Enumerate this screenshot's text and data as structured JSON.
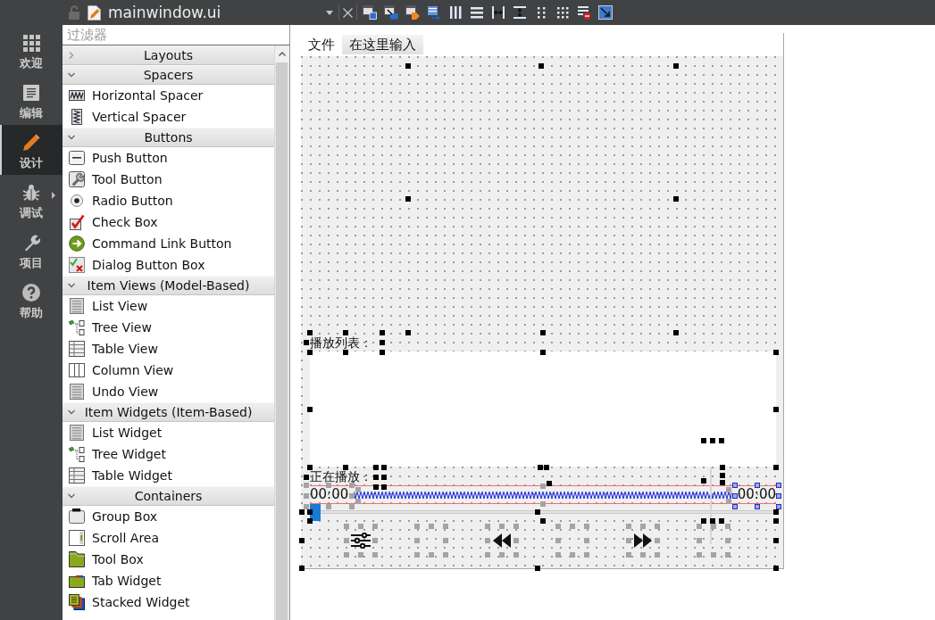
{
  "top_bar": {
    "file_name": "mainwindow.ui"
  },
  "mode_bar": {
    "items": [
      {
        "label": "欢迎",
        "selected": false
      },
      {
        "label": "编辑",
        "selected": false
      },
      {
        "label": "设计",
        "selected": true
      },
      {
        "label": "调试",
        "selected": false
      },
      {
        "label": "项目",
        "selected": false
      },
      {
        "label": "帮助",
        "selected": false
      }
    ]
  },
  "widget_box": {
    "filter": {
      "placeholder": "过滤器"
    },
    "categories": [
      {
        "title": "Layouts",
        "expanded": false
      },
      {
        "title": "Spacers",
        "expanded": true,
        "items": [
          {
            "label": "Horizontal Spacer"
          },
          {
            "label": "Vertical Spacer"
          }
        ]
      },
      {
        "title": "Buttons",
        "expanded": true,
        "items": [
          {
            "label": "Push Button"
          },
          {
            "label": "Tool Button"
          },
          {
            "label": "Radio Button"
          },
          {
            "label": "Check Box"
          },
          {
            "label": "Command Link Button"
          },
          {
            "label": "Dialog Button Box"
          }
        ]
      },
      {
        "title": "Item Views (Model-Based)",
        "expanded": true,
        "items": [
          {
            "label": "List View"
          },
          {
            "label": "Tree View"
          },
          {
            "label": "Table View"
          },
          {
            "label": "Column View"
          },
          {
            "label": "Undo View"
          }
        ]
      },
      {
        "title": "Item Widgets (Item-Based)",
        "expanded": true,
        "items": [
          {
            "label": "List Widget"
          },
          {
            "label": "Tree Widget"
          },
          {
            "label": "Table Widget"
          }
        ]
      },
      {
        "title": "Containers",
        "expanded": true,
        "items": [
          {
            "label": "Group Box"
          },
          {
            "label": "Scroll Area"
          },
          {
            "label": "Tool Box"
          },
          {
            "label": "Tab Widget"
          },
          {
            "label": "Stacked Widget"
          }
        ]
      }
    ]
  },
  "form": {
    "menu_bar": {
      "menus": [
        "文件"
      ],
      "type_here": "在这里输入"
    },
    "playlist_label": "播放列表：",
    "now_playing_label": "正在播放：",
    "time_elapsed": "00:00",
    "time_total": "00:00",
    "position_slider": {
      "level": 0
    }
  }
}
